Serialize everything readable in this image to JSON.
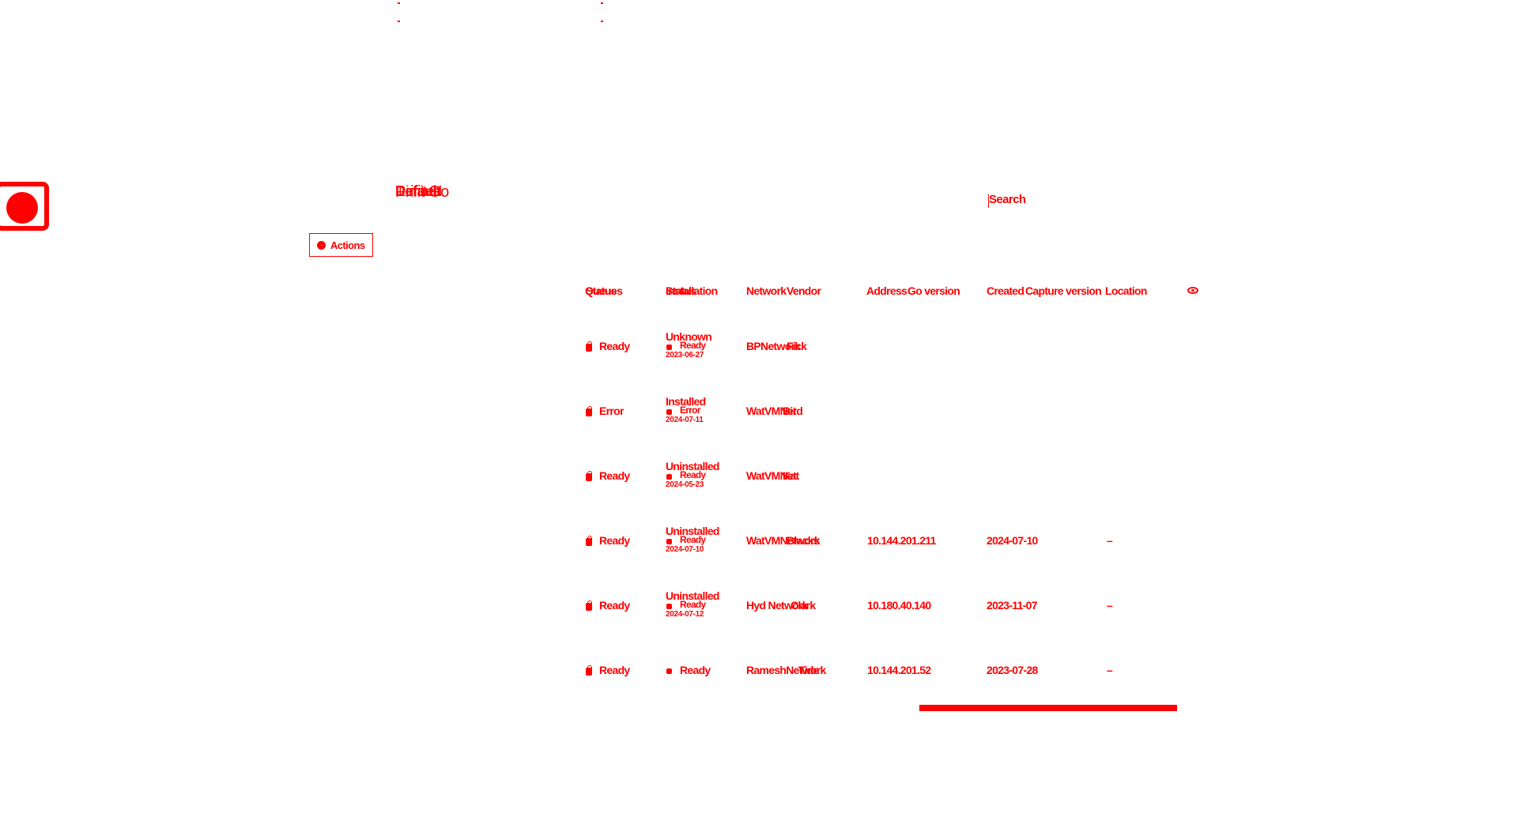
{
  "app": {
    "title_layers": [
      "Prifit Go",
      "Default",
      "Limited"
    ]
  },
  "search": {
    "label": "Search"
  },
  "toolbar": {
    "actions_label": "Actions"
  },
  "table": {
    "headers": {
      "queue": "Queues",
      "status": "Status",
      "installation": "Installation",
      "network": "Network",
      "vendor": "Vendor",
      "address": "Address",
      "go_version": "Go version",
      "created": "Created",
      "capture_version": "Capture version",
      "location": "Location"
    },
    "rows": [
      {
        "status": "Ready",
        "installation": "Unknown",
        "inst_status": "Ready",
        "inst_date": "2023-06-27",
        "network": "BPNetwork",
        "vendor": "Fick",
        "address": "",
        "created": "",
        "location": ""
      },
      {
        "status": "Error",
        "installation": "Installed",
        "inst_status": "Error",
        "inst_date": "2024-07-11",
        "network": "WatVMNet",
        "vendor": "Bird",
        "address": "",
        "created": "",
        "location": ""
      },
      {
        "status": "Ready",
        "installation": "Uninstalled",
        "inst_status": "Ready",
        "inst_date": "2024-05-23",
        "network": "WatVMNet",
        "vendor": "Kat",
        "address": "",
        "created": "",
        "location": ""
      },
      {
        "status": "Ready",
        "installation": "Uninstalled",
        "inst_status": "Ready",
        "inst_date": "2024-07-10",
        "network": "WatVMNetwork",
        "vendor": "Blacks",
        "address": "10.144.201.211",
        "created": "2024-07-10",
        "location": "–"
      },
      {
        "status": "Ready",
        "installation": "Uninstalled",
        "inst_status": "Ready",
        "inst_date": "2024-07-12",
        "network": "Hyd Network",
        "vendor": "Clark",
        "address": "10.180.40.140",
        "created": "2023-11-07",
        "location": "–"
      },
      {
        "status": "Ready",
        "installation": "",
        "inst_status": "Ready",
        "inst_date": "",
        "network": "RameshNetwork",
        "vendor": "Tide",
        "address": "10.144.201.52",
        "created": "2023-07-28",
        "location": "–"
      }
    ]
  },
  "colors": {
    "accent": "#ff0000",
    "background": "#ffffff"
  },
  "icons": [
    "record-icon",
    "gear-icon",
    "lock-icon",
    "status-dot-icon",
    "eye-icon"
  ]
}
